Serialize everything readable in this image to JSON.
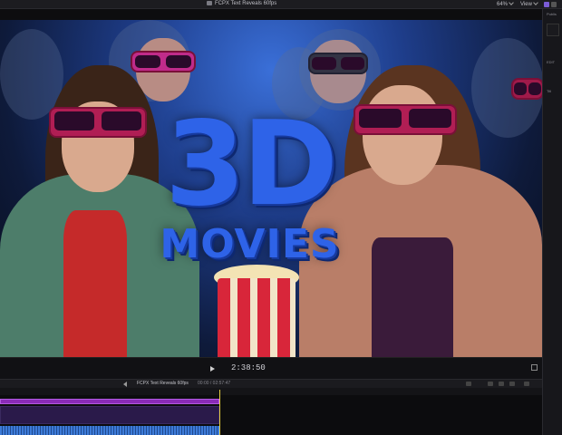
{
  "window": {
    "title": "FCPX Text Reveals 60fps",
    "zoom": "64%",
    "view_label": "View"
  },
  "viewer": {
    "title_line1": "3D",
    "title_line2": "MOVIES",
    "title_color": "#2e63e8"
  },
  "controls": {
    "timecode": "2:38:50"
  },
  "timeline": {
    "project_name": "FCPX Text Reveals 60fps",
    "duration": "00:00 / 02:57:47"
  },
  "inspector": {
    "labels": [
      "Publis",
      "EDIT",
      "Titl"
    ]
  },
  "colors": {
    "accent_purple": "#8a2bb8",
    "playhead": "#e8d040",
    "audio": "#3d7bd8"
  }
}
